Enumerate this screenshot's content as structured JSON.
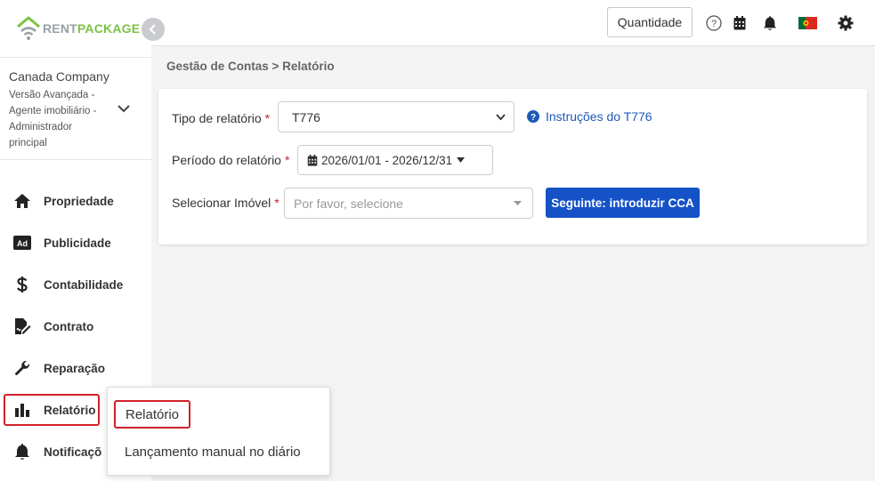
{
  "brand": {
    "name_part1": "RENT",
    "name_part2": "PACKAGE",
    "primary_color": "#7cc242",
    "secondary_color": "#9aa0a6"
  },
  "company": {
    "name": "Canada Company",
    "role_lines": [
      "Versão Avançada -",
      "Agente imobiliário -",
      "Administrador",
      "principal"
    ]
  },
  "sidebar": {
    "items": [
      {
        "label": "Propriedade",
        "icon": "home-icon"
      },
      {
        "label": "Publicidade",
        "icon": "ad-icon"
      },
      {
        "label": "Contabilidade",
        "icon": "dollar-icon"
      },
      {
        "label": "Contrato",
        "icon": "contract-sign-icon"
      },
      {
        "label": "Reparação",
        "icon": "wrench-icon"
      },
      {
        "label": "Relatório",
        "icon": "bar-chart-icon",
        "active": true
      },
      {
        "label": "Notificaçõ",
        "icon": "bell-icon"
      }
    ]
  },
  "topbar": {
    "quantity_label": "Quantidade",
    "icons": [
      "help-icon",
      "calendar-icon",
      "bell-icon",
      "portugal-flag-icon",
      "gear-icon"
    ]
  },
  "breadcrumb": "Gestão de Contas > Relatório",
  "form": {
    "report_type": {
      "label": "Tipo de relatório",
      "value": "T776"
    },
    "instructions_link": "Instruções do T776",
    "period": {
      "label": "Período do relatório",
      "value": "2026/01/01 - 2026/12/31"
    },
    "property": {
      "label": "Selecionar Imóvel",
      "placeholder": "Por favor, selecione"
    },
    "next_button": "Seguinte: introduzir CCA",
    "required_mark": "*"
  },
  "submenu": {
    "items": [
      "Relatório",
      "Lançamento manual no diário"
    ]
  },
  "colors": {
    "accent_blue": "#1552c7",
    "link_blue": "#1d5ab4",
    "required_red": "#d0202a"
  }
}
